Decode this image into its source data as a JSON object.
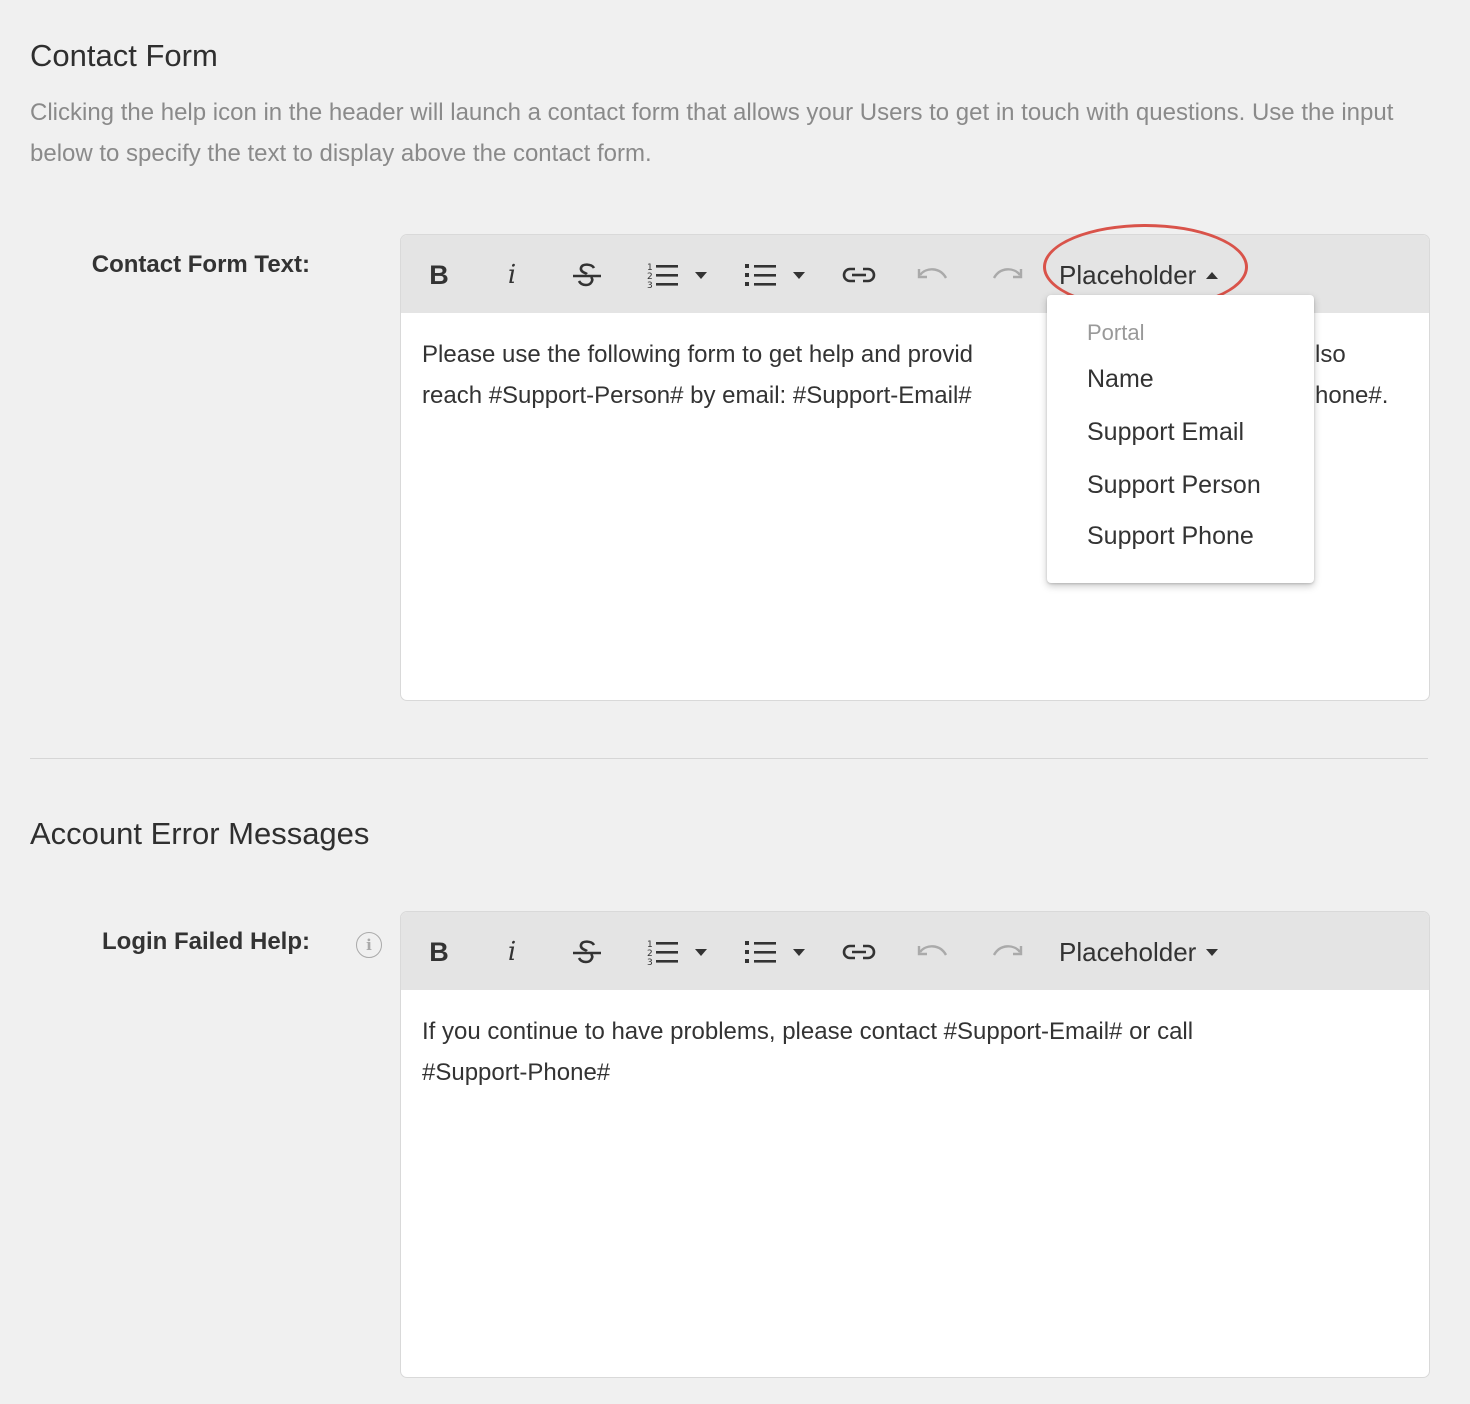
{
  "contact_form": {
    "title": "Contact Form",
    "description": "Clicking the help icon in the header will launch a contact form that allows your Users to get in touch with questions. Use the input below to specify the text to display above the contact form.",
    "field_label": "Contact Form Text:",
    "editor": {
      "toolbar": {
        "bold": "B",
        "italic": "i",
        "placeholder_label": "Placeholder",
        "placeholder_open": true
      },
      "content_line1_left": "Please use the following form to get help and provid",
      "content_line1_right": "lso",
      "content_line2_left": "reach #Support-Person# by email: #Support-Email#",
      "content_line2_right": "hone#."
    },
    "placeholder_menu": {
      "group_header": "Portal",
      "items": [
        "Name",
        "Support Email",
        "Support Person",
        "Support Phone"
      ]
    },
    "highlight_color": "#d9534a"
  },
  "account_errors": {
    "title": "Account Error Messages",
    "field_label": "Login Failed Help:",
    "info_icon_glyph": "i",
    "editor": {
      "toolbar": {
        "bold": "B",
        "italic": "i",
        "placeholder_label": "Placeholder",
        "placeholder_open": false
      },
      "content": "If you continue to have problems, please contact #Support-Email# or call #Support-Phone#"
    }
  }
}
